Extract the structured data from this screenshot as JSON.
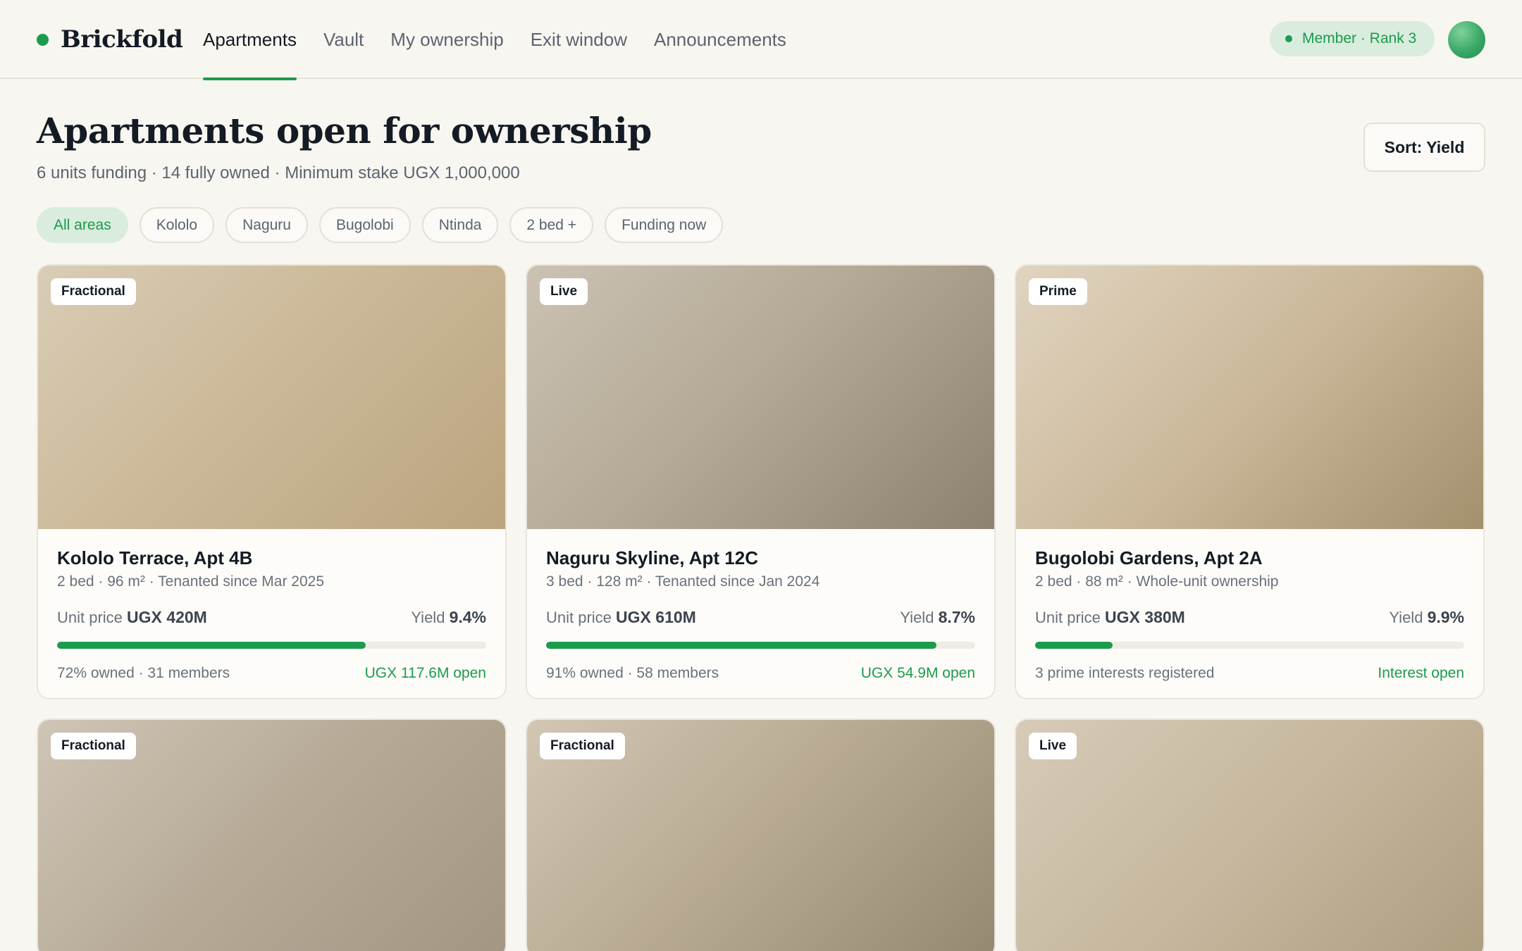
{
  "brand": {
    "name": "Brickfold"
  },
  "nav": {
    "items": [
      {
        "label": "Apartments",
        "active": true
      },
      {
        "label": "Vault"
      },
      {
        "label": "My ownership"
      },
      {
        "label": "Exit window"
      },
      {
        "label": "Announcements"
      }
    ]
  },
  "member_badge": {
    "label": "Member · Rank 3"
  },
  "page": {
    "title": "Apartments open for ownership",
    "subtitle": "6 units funding · 14 fully owned · Minimum stake UGX 1,000,000",
    "sort_label": "Sort: Yield"
  },
  "filters": [
    {
      "label": "All areas",
      "active": true
    },
    {
      "label": "Kololo"
    },
    {
      "label": "Naguru"
    },
    {
      "label": "Bugolobi"
    },
    {
      "label": "Ntinda"
    },
    {
      "label": "2 bed +"
    },
    {
      "label": "Funding now"
    }
  ],
  "colors": {
    "accent": "#1c9b4c",
    "accent_soft": "#d9ecdd",
    "background": "#f8f6f0"
  },
  "cards": [
    {
      "tag": "Fractional",
      "title": "Kololo Terrace, Apt 4B",
      "meta": "2 bed · 96 m² · Tenanted since Mar 2025",
      "price_label": "Unit price",
      "price": "UGX 420M",
      "yield_label": "Yield",
      "yield": "9.4%",
      "progress": 0.72,
      "foot_left": "72% owned · 31 members",
      "foot_right": "UGX 117.6M open"
    },
    {
      "tag": "Live",
      "title": "Naguru Skyline, Apt 12C",
      "meta": "3 bed · 128 m² · Tenanted since Jan 2024",
      "price_label": "Unit price",
      "price": "UGX 610M",
      "yield_label": "Yield",
      "yield": "8.7%",
      "progress": 0.91,
      "foot_left": "91% owned · 58 members",
      "foot_right": "UGX 54.9M open"
    },
    {
      "tag": "Prime",
      "title": "Bugolobi Gardens, Apt 2A",
      "meta": "2 bed · 88 m² · Whole-unit ownership",
      "price_label": "Unit price",
      "price": "UGX 380M",
      "yield_label": "Yield",
      "yield": "9.9%",
      "progress": 0.18,
      "foot_left": "3 prime interests registered",
      "foot_right": "Interest open"
    },
    {
      "tag": "Fractional"
    },
    {
      "tag": "Fractional"
    },
    {
      "tag": "Live"
    }
  ]
}
